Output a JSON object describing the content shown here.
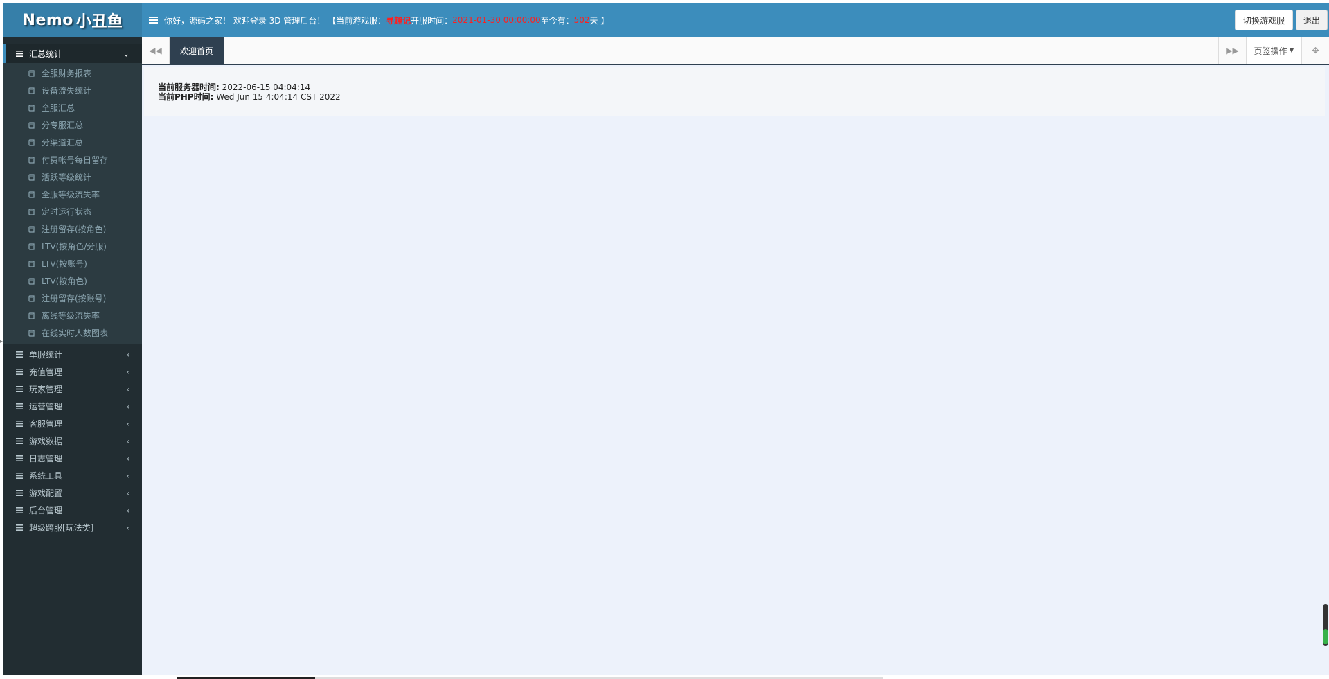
{
  "header": {
    "logo_latin": "Nemo",
    "logo_cjk": "小丑鱼",
    "welcome_prefix": "你好，源码之家！ 欢迎登录 3D 管理后台！ 【当前游戏服：",
    "server_name": "寻趣记",
    "open_time_label": " 开服时间：",
    "open_time": "2021-01-30 00:00:00",
    "days_label": " 至今有：",
    "days": "502",
    "days_suffix": "天 】",
    "switch_server": "切换游戏服",
    "logout": "退出"
  },
  "sidebar": {
    "active_group": "汇总统计",
    "sub_items": [
      "全服财务报表",
      "设备流失统计",
      "全服汇总",
      "分专服汇总",
      "分渠道汇总",
      "付费帐号每日留存",
      "活跃等级统计",
      "全服等级流失率",
      "定时运行状态",
      "注册留存(按角色)",
      "LTV(按角色/分服)",
      "LTV(按账号)",
      "LTV(按角色)",
      "注册留存(按账号)",
      "离线等级流失率",
      "在线实时人数图表"
    ],
    "groups": [
      "单服统计",
      "充值管理",
      "玩家管理",
      "运营管理",
      "客服管理",
      "游戏数据",
      "日志管理",
      "系统工具",
      "游戏配置",
      "后台管理",
      "超级跨服[玩法类]"
    ]
  },
  "tabs": {
    "active": "欢迎首页",
    "ops": "页签操作"
  },
  "content": {
    "server_time_label": "当前服务器时间:",
    "server_time": " 2022-06-15 04:04:14",
    "php_time_label": "当前PHP时间:",
    "php_time": " Wed Jun 15 4:04:14 CST 2022"
  },
  "colors": {
    "header_bg": "#3c8dbc",
    "logo_bg": "#367fa9",
    "sidebar_bg": "#222d32",
    "active_tab": "#2f4050",
    "highlight_red": "#ff1f1f"
  }
}
